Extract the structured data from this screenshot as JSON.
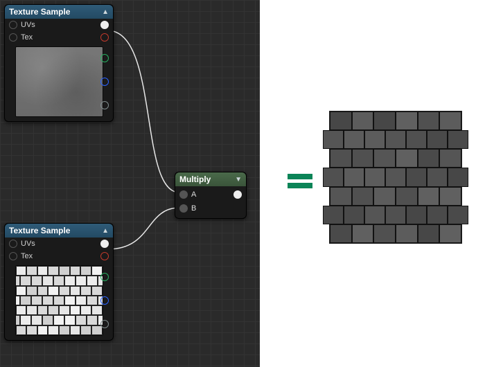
{
  "nodes": {
    "tex1": {
      "title": "Texture Sample",
      "inputs": {
        "uv": "UVs",
        "tex": "Tex"
      },
      "pins": [
        "white",
        "red",
        "green",
        "blue",
        "grey"
      ]
    },
    "tex2": {
      "title": "Texture Sample",
      "inputs": {
        "uv": "UVs",
        "tex": "Tex"
      },
      "pins": [
        "white",
        "red",
        "green",
        "blue",
        "grey"
      ]
    },
    "mult": {
      "title": "Multiply",
      "inputs": {
        "a": "A",
        "b": "B"
      }
    }
  },
  "equals": "=",
  "result_label": "multiplied-texture-result"
}
